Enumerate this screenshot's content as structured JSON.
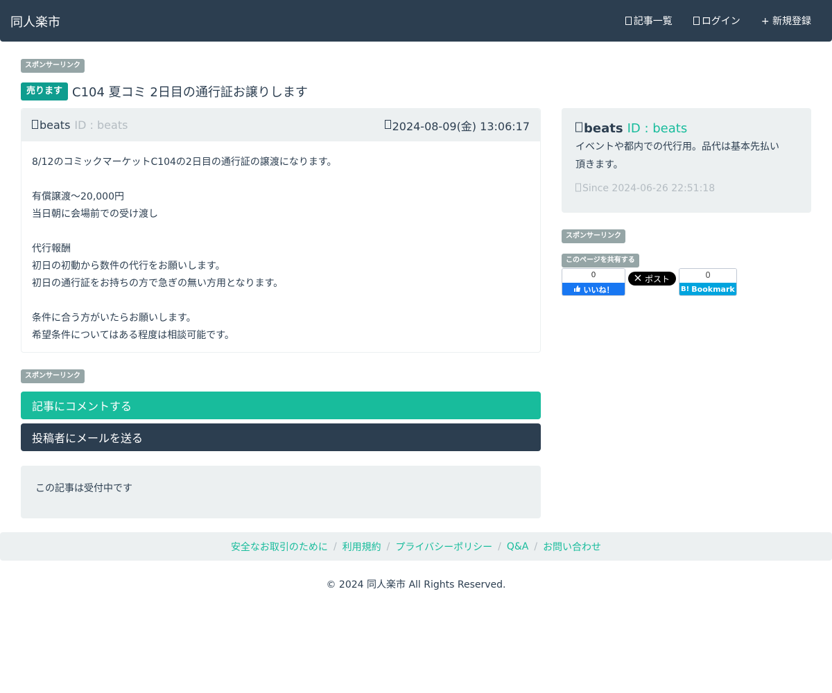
{
  "navbar": {
    "brand": "同人楽市",
    "links": [
      {
        "label": "記事一覧",
        "icon": "list-icon"
      },
      {
        "label": "ログイン",
        "icon": "login-icon"
      },
      {
        "label": "+ 新規登録",
        "icon": ""
      }
    ]
  },
  "sponsor_label": "スポンサーリンク",
  "post": {
    "badge": "売ります",
    "title": "C104 夏コミ 2日目の通行証お譲りします",
    "author": "beats",
    "author_id": "ID : beats",
    "date": "2024-08-09(金) 13:06:17",
    "body": [
      "8/12のコミックマーケットC104の2日目の通行証の譲渡になります。",
      "",
      "有償譲渡〜20,000円",
      "当日朝に会場前での受け渡し",
      "",
      "代行報酬",
      "初日の初動から数件の代行をお願いします。",
      "初日の通行証をお持ちの方で急ぎの無い方用となります。",
      "",
      "条件に合う方がいたらお願いします。",
      "希望条件についてはある程度は相談可能です。"
    ]
  },
  "actions": {
    "comment": "記事にコメントする",
    "mail": "投稿者にメールを送る"
  },
  "status": "この記事は受付中です",
  "sidebar": {
    "name": "beats",
    "id": "ID : beats",
    "desc_line1": "イベントや都内での代行用。品代は基本先払い",
    "desc_line2": "頂きます。",
    "since": "Since 2024-06-26 22:51:18"
  },
  "share": {
    "label": "このページを共有する",
    "fb_count": "0",
    "fb_label": "いいね！",
    "x_label": "ポスト",
    "hatena_count": "0",
    "hatena_label": "Bookmark"
  },
  "footer": {
    "links": [
      "安全なお取引のために",
      "利用規約",
      "プライバシーポリシー",
      "Q&A",
      "お問い合わせ"
    ],
    "copyright": "© 2024 同人楽市 All Rights Reserved."
  },
  "colors": {
    "primary": "#2c3e50",
    "success": "#18bc9c",
    "muted": "#b4bcc2",
    "well": "#ecf0f1"
  }
}
